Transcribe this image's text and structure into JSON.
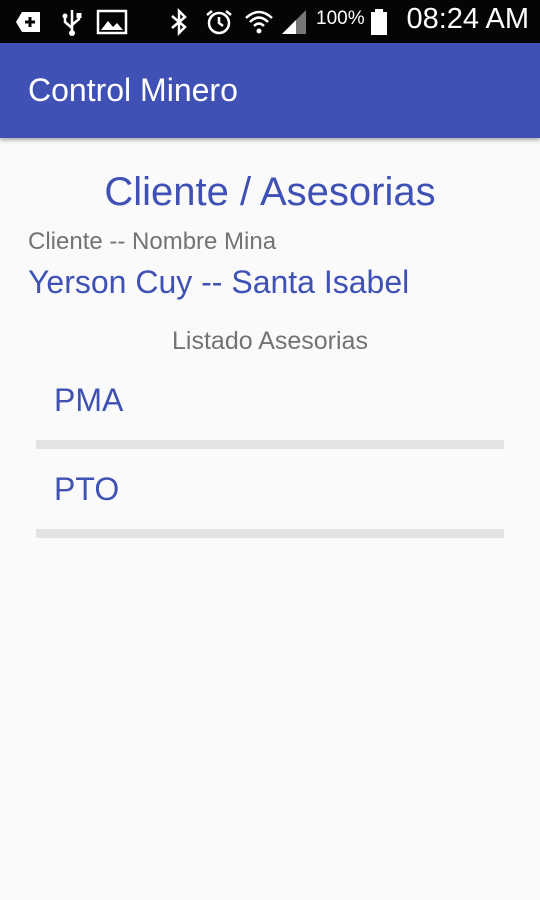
{
  "status_bar": {
    "battery_text": "100%",
    "time": "08:24 AM",
    "icons": [
      "add-icon",
      "usb-icon",
      "image-icon",
      "bluetooth-icon",
      "alarm-icon",
      "wifi-icon",
      "signal-icon",
      "battery-icon"
    ]
  },
  "app_bar": {
    "title": "Control Minero",
    "color": "#3f51b5"
  },
  "content": {
    "title": "Cliente / Asesorias",
    "client_label": "Cliente -- Nombre Mina",
    "client_value": "Yerson Cuy -- Santa Isabel",
    "list_header": "Listado Asesorias",
    "items": [
      {
        "label": "PMA"
      },
      {
        "label": "PTO"
      }
    ]
  }
}
